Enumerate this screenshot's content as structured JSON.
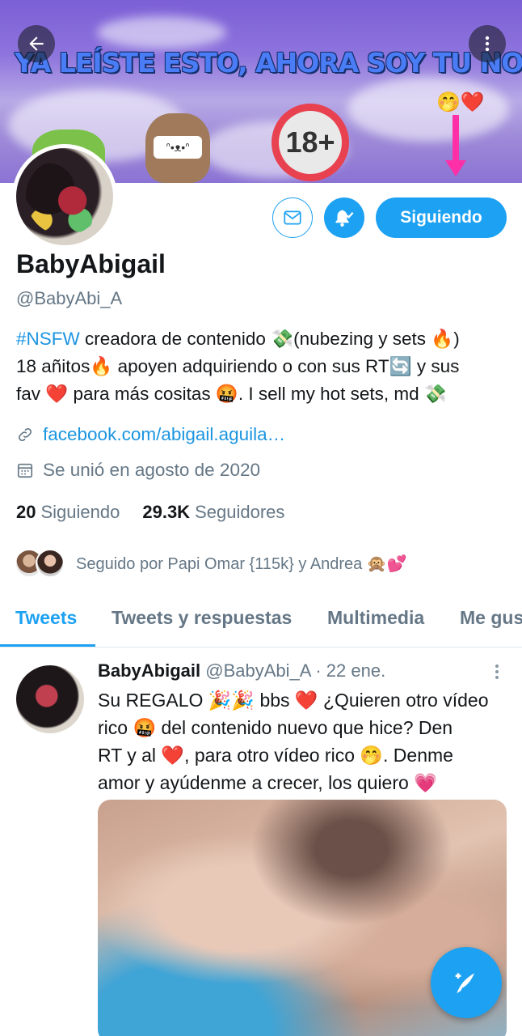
{
  "banner": {
    "text": "YA LEÍSTE ESTO, AHORA SOY TU NOVIA, SÍGUEME",
    "badge": "18+",
    "emojis": "🤭❤️"
  },
  "profile": {
    "name": "BabyAbigail",
    "handle": "@BabyAbi_A",
    "follow_label": "Siguiendo",
    "bio_hashtag": "#NSFW",
    "bio_line1": " creadora de contenido 💸(nubezing y sets 🔥)",
    "bio_line2": "18 añitos🔥 apoyen adquiriendo o con sus RT🔄 y sus",
    "bio_line3": "fav ❤️ para más cositas 🤬. I sell my hot sets, md 💸",
    "website": "facebook.com/abigail.aguila…",
    "joined": "Se unió en agosto de 2020",
    "following_count": "20",
    "following_label": "Siguiendo",
    "followers_count": "29.3K",
    "followers_label": "Seguidores",
    "followed_by": "Seguido por Papi Omar {115k} y Andrea 🙊💕"
  },
  "tabs": [
    "Tweets",
    "Tweets y respuestas",
    "Multimedia",
    "Me gusta"
  ],
  "tweet": {
    "author": "BabyAbigail",
    "handle_date": " @BabyAbi_A · 22 ene.",
    "line1": "Su REGALO 🎉🎉 bbs ❤️ ¿Quieren otro vídeo",
    "line2": "rico 🤬 del contenido nuevo que hice? Den",
    "line3": "RT y al ❤️, para otro vídeo rico 🤭. Denme",
    "line4": "amor y ayúdenme a crecer, los quiero 💗"
  },
  "colors": {
    "accent": "#1da1f2",
    "text": "#14171a",
    "muted": "#657786"
  }
}
